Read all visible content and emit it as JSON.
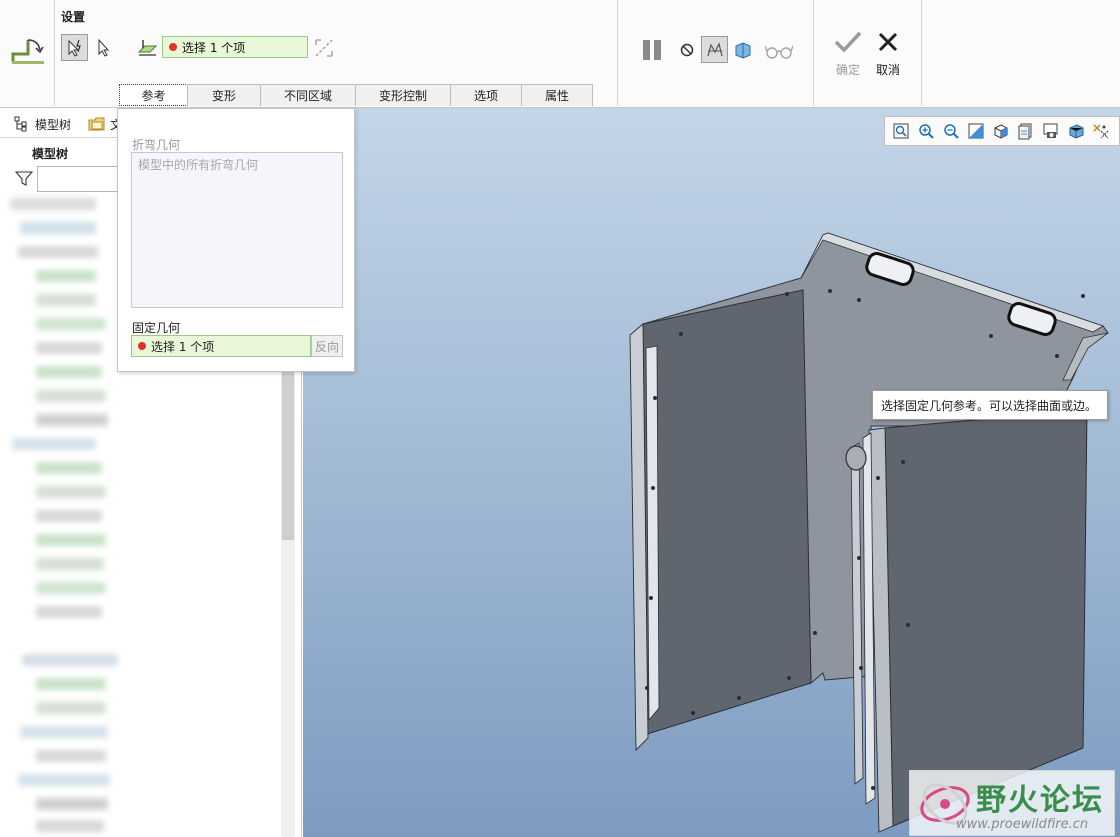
{
  "ribbon": {
    "group_title": "设置",
    "collector_text": "选择 1 个项",
    "tabs": [
      "参考",
      "变形",
      "不同区域",
      "变形控制",
      "选项",
      "属性"
    ],
    "active_tab": "参考",
    "confirm_label": "确定",
    "cancel_label": "取消"
  },
  "left_panel": {
    "tab_model_tree": "模型树",
    "tab_second_partial": "文",
    "title": "模型树"
  },
  "reference_panel": {
    "bend_geometry_label": "折弯几何",
    "bend_geometry_placeholder": "模型中的所有折弯几何",
    "fixed_geometry_label": "固定几何",
    "fixed_geometry_value": "选择 1 个项",
    "flip_button": "反向"
  },
  "viewport": {
    "tooltip": "选择固定几何参考。可以选择曲面或边。"
  },
  "watermark": {
    "title": "野火论坛",
    "url": "www.proewildfire.cn"
  },
  "colors": {
    "collector_bg": "#e7f7d8",
    "required_dot": "#e0302a",
    "viewport_top": "#c3d5e8",
    "viewport_bottom": "#7d9bc1",
    "model_face": "#5f6670"
  }
}
